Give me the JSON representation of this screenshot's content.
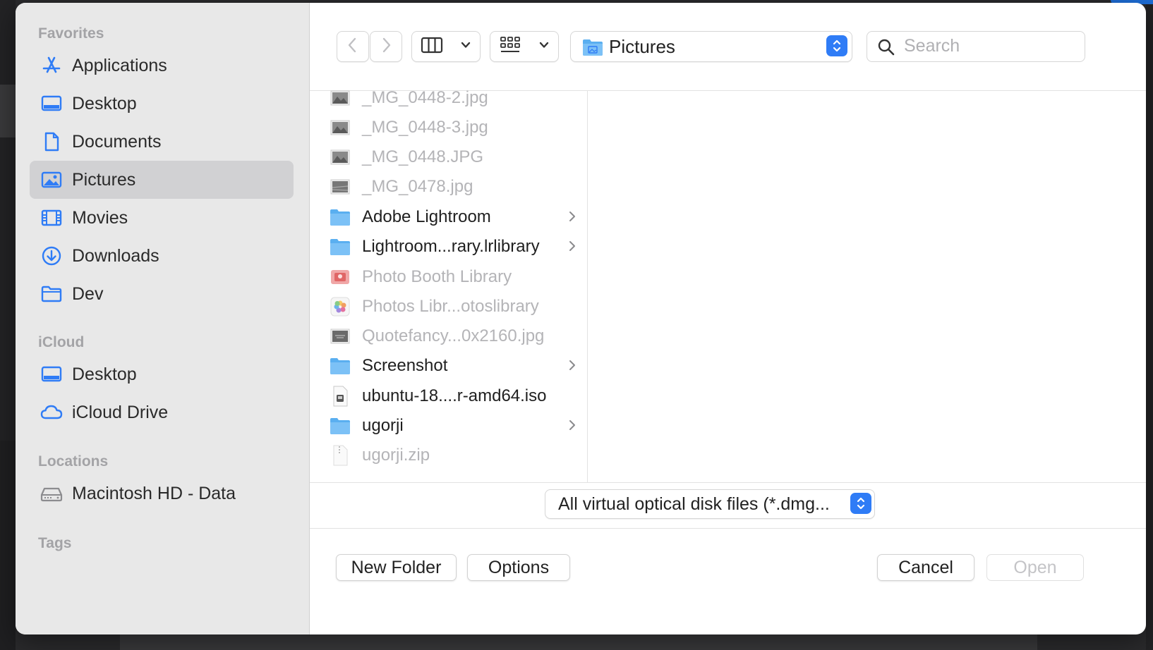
{
  "sidebar": {
    "favorites_heading": "Favorites",
    "favorites": [
      {
        "label": "Applications",
        "icon": "applications-icon"
      },
      {
        "label": "Desktop",
        "icon": "desktop-icon"
      },
      {
        "label": "Documents",
        "icon": "document-icon"
      },
      {
        "label": "Pictures",
        "icon": "pictures-icon",
        "selected": true
      },
      {
        "label": "Movies",
        "icon": "film-icon"
      },
      {
        "label": "Downloads",
        "icon": "download-icon"
      },
      {
        "label": "Dev",
        "icon": "folder-icon"
      }
    ],
    "icloud_heading": "iCloud",
    "icloud": [
      {
        "label": "Desktop",
        "icon": "desktop-icon"
      },
      {
        "label": "iCloud Drive",
        "icon": "cloud-icon"
      }
    ],
    "locations_heading": "Locations",
    "locations": [
      {
        "label": "Macintosh HD - Data",
        "icon": "drive-icon"
      }
    ],
    "tags_heading": "Tags"
  },
  "toolbar": {
    "current_folder": "Pictures",
    "search_placeholder": "Search"
  },
  "files": [
    {
      "name": "_MG_0448-2.jpg",
      "kind": "image",
      "dim": true
    },
    {
      "name": "_MG_0448-3.jpg",
      "kind": "image",
      "dim": true
    },
    {
      "name": "_MG_0448.JPG",
      "kind": "image",
      "dim": true
    },
    {
      "name": "_MG_0478.jpg",
      "kind": "image",
      "dim": true
    },
    {
      "name": "Adobe Lightroom",
      "kind": "folder",
      "dim": false
    },
    {
      "name": "Lightroom...rary.lrlibrary",
      "kind": "folder",
      "dim": false
    },
    {
      "name": "Photo Booth Library",
      "kind": "photobooth",
      "dim": true
    },
    {
      "name": "Photos Libr...otoslibrary",
      "kind": "photos",
      "dim": true
    },
    {
      "name": "Quotefancy...0x2160.jpg",
      "kind": "image",
      "dim": true
    },
    {
      "name": "Screenshot",
      "kind": "folder",
      "dim": false
    },
    {
      "name": "ubuntu-18....r-amd64.iso",
      "kind": "disk",
      "dim": false
    },
    {
      "name": "ugorji",
      "kind": "folder",
      "dim": false
    },
    {
      "name": "ugorji.zip",
      "kind": "zip",
      "dim": true
    }
  ],
  "filter": {
    "selected": "All virtual optical disk files (*.dmg..."
  },
  "buttons": {
    "new_folder": "New Folder",
    "options": "Options",
    "cancel": "Cancel",
    "open": "Open"
  },
  "colors": {
    "accent": "#2f7cf6",
    "sidebar_icon": "#2f7cf6",
    "folder": "#5aaff0"
  }
}
